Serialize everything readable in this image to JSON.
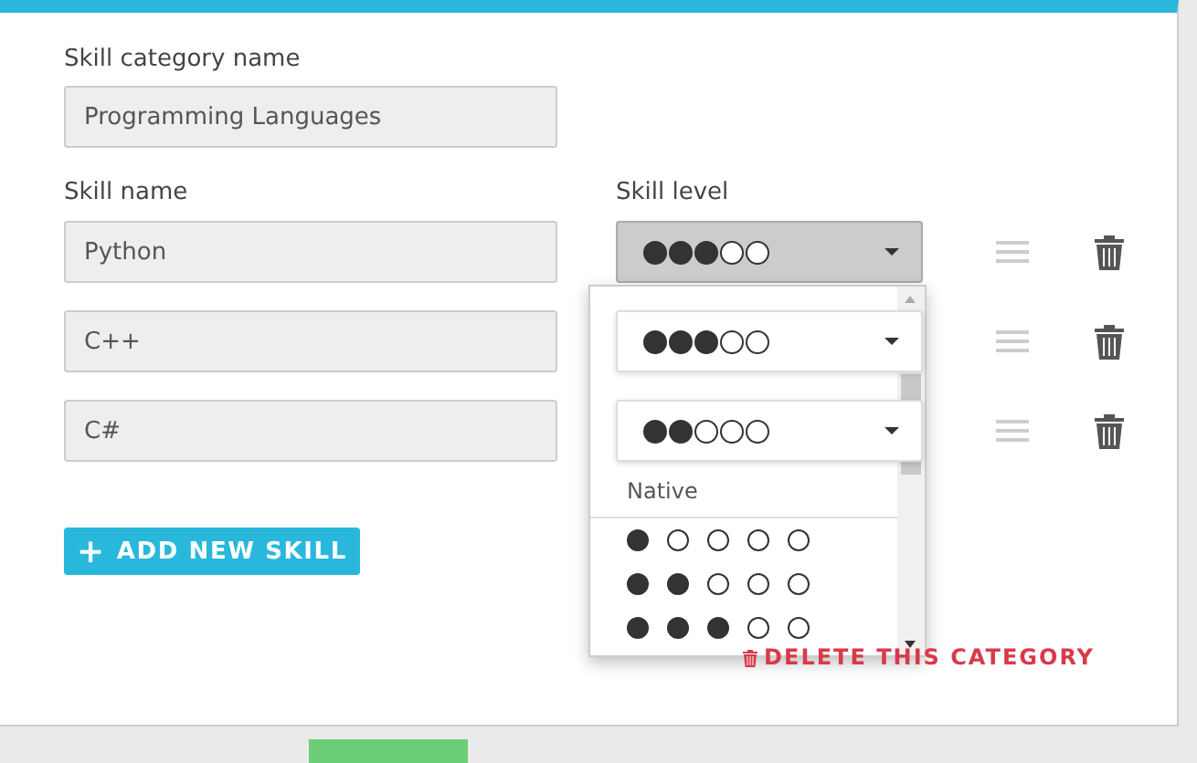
{
  "category": {
    "label": "Skill category name",
    "value": "Programming Languages"
  },
  "columns": {
    "skill_name": "Skill name",
    "skill_level": "Skill level"
  },
  "skills": [
    {
      "name": "Python",
      "stars": 3,
      "open": true
    },
    {
      "name": "C++",
      "stars": 3,
      "open": false
    },
    {
      "name": "C#",
      "stars": 2,
      "open": false
    }
  ],
  "level_menu": [
    {
      "kind": "header",
      "label": "Native"
    },
    {
      "kind": "option",
      "stars": 1
    },
    {
      "kind": "option",
      "stars": 2
    },
    {
      "kind": "option",
      "stars": 3
    }
  ],
  "add_button": {
    "icon": "+",
    "label": "ADD NEW SKILL"
  },
  "delete_link": "DELETE THIS CATEGORY"
}
